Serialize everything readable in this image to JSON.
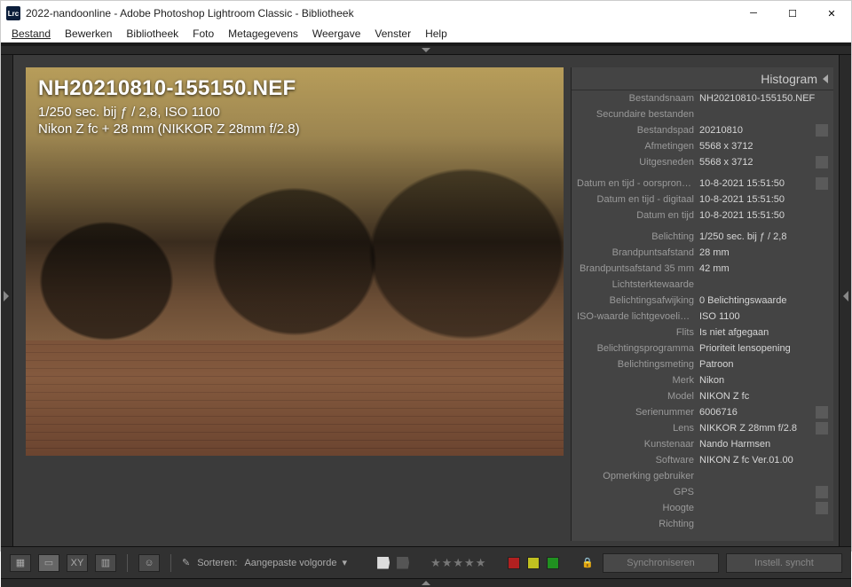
{
  "window": {
    "title": "2022-nandoonline - Adobe Photoshop Lightroom Classic - Bibliotheek",
    "appicon": "Lrc"
  },
  "menubar": [
    "Bestand",
    "Bewerken",
    "Bibliotheek",
    "Foto",
    "Metagegevens",
    "Weergave",
    "Venster",
    "Help"
  ],
  "overlay": {
    "filename": "NH20210810-155150.NEF",
    "exposure": "1/250 sec. bij ƒ / 2,8, ISO 1100",
    "camera_lens": "Nikon Z fc + 28 mm (NIKKOR Z 28mm f/2.8)"
  },
  "panel": {
    "header": "Histogram",
    "groups": [
      [
        {
          "label": "Bestandsnaam",
          "value": "NH20210810-155150.NEF",
          "action": false
        },
        {
          "label": "Secundaire bestanden",
          "value": "",
          "action": false
        },
        {
          "label": "Bestandspad",
          "value": "20210810",
          "action": true
        },
        {
          "label": "Afmetingen",
          "value": "5568 x 3712",
          "action": false
        },
        {
          "label": "Uitgesneden",
          "value": "5568 x 3712",
          "action": true
        }
      ],
      [
        {
          "label": "Datum en tijd - oorspronkelijk",
          "value": "10-8-2021 15:51:50",
          "action": true
        },
        {
          "label": "Datum en tijd - digitaal",
          "value": "10-8-2021 15:51:50",
          "action": false
        },
        {
          "label": "Datum en tijd",
          "value": "10-8-2021 15:51:50",
          "action": false
        }
      ],
      [
        {
          "label": "Belichting",
          "value": "1/250 sec. bij ƒ / 2,8",
          "action": false
        },
        {
          "label": "Brandpuntsafstand",
          "value": "28 mm",
          "action": false
        },
        {
          "label": "Brandpuntsafstand 35 mm",
          "value": "42 mm",
          "action": false
        },
        {
          "label": "Lichtsterktewaarde",
          "value": "",
          "action": false
        },
        {
          "label": "Belichtingsafwijking",
          "value": "0 Belichtingswaarde",
          "action": false
        },
        {
          "label": "ISO-waarde lichtgevoeligheid",
          "value": "ISO 1100",
          "action": false
        },
        {
          "label": "Flits",
          "value": "Is niet afgegaan",
          "action": false
        },
        {
          "label": "Belichtingsprogramma",
          "value": "Prioriteit lensopening",
          "action": false
        },
        {
          "label": "Belichtingsmeting",
          "value": "Patroon",
          "action": false
        },
        {
          "label": "Merk",
          "value": "Nikon",
          "action": false
        },
        {
          "label": "Model",
          "value": "NIKON Z fc",
          "action": false
        },
        {
          "label": "Serienummer",
          "value": "6006716",
          "action": true
        },
        {
          "label": "Lens",
          "value": "NIKKOR Z 28mm f/2.8",
          "action": true
        },
        {
          "label": "Kunstenaar",
          "value": "Nando Harmsen",
          "action": false
        },
        {
          "label": "Software",
          "value": "NIKON Z fc Ver.01.00",
          "action": false
        },
        {
          "label": "Opmerking gebruiker",
          "value": "",
          "action": false
        },
        {
          "label": "GPS",
          "value": "",
          "action": true
        },
        {
          "label": "Hoogte",
          "value": "",
          "action": true
        },
        {
          "label": "Richting",
          "value": "",
          "action": false
        }
      ]
    ]
  },
  "toolbar": {
    "sort_label": "Sorteren:",
    "sort_value": "Aangepaste volgorde",
    "stars": "★★★★★",
    "colors": [
      "#b02020",
      "#c0c020",
      "#209020"
    ],
    "sync_btn": "Synchroniseren",
    "settings_sync_btn": "Instell. syncht"
  }
}
